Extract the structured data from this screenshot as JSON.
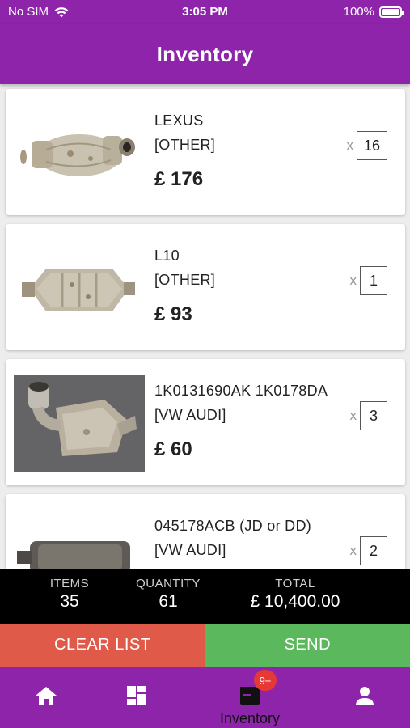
{
  "status_bar": {
    "carrier": "No SIM",
    "time": "3:05 PM",
    "battery": "100%"
  },
  "header": {
    "title": "Inventory"
  },
  "items": [
    {
      "name": "LEXUS",
      "make": "[OTHER]",
      "price": "£ 176",
      "qty_prefix": "x",
      "qty": "16",
      "image": "catalytic-converter-oval"
    },
    {
      "name": "L10",
      "make": "[OTHER]",
      "price": "£ 93",
      "qty_prefix": "x",
      "qty": "1",
      "image": "catalytic-converter-hex"
    },
    {
      "name": "1K0131690AK 1K0178DA",
      "make": "[VW AUDI]",
      "price": "£ 60",
      "qty_prefix": "x",
      "qty": "3",
      "image": "catalytic-converter-photo"
    },
    {
      "name": "045178ACB (JD or DD)",
      "make": "[VW AUDI]",
      "price": "",
      "qty_prefix": "x",
      "qty": "2",
      "image": "catalytic-converter-long"
    }
  ],
  "summary": {
    "items_label": "ITEMS",
    "items_value": "35",
    "quantity_label": "QUANTITY",
    "quantity_value": "61",
    "total_label": "TOTAL",
    "total_value": "£ 10,400.00"
  },
  "actions": {
    "clear_label": "CLEAR LIST",
    "send_label": "SEND"
  },
  "tabbar": {
    "home_icon": "home-icon",
    "dashboard_icon": "dashboard-icon",
    "inventory_label": "Inventory",
    "inventory_badge": "9+",
    "profile_icon": "person-icon"
  },
  "colors": {
    "primary": "#8e24aa",
    "clear": "#e05a4a",
    "send": "#5cb85c",
    "badge": "#e53935"
  }
}
